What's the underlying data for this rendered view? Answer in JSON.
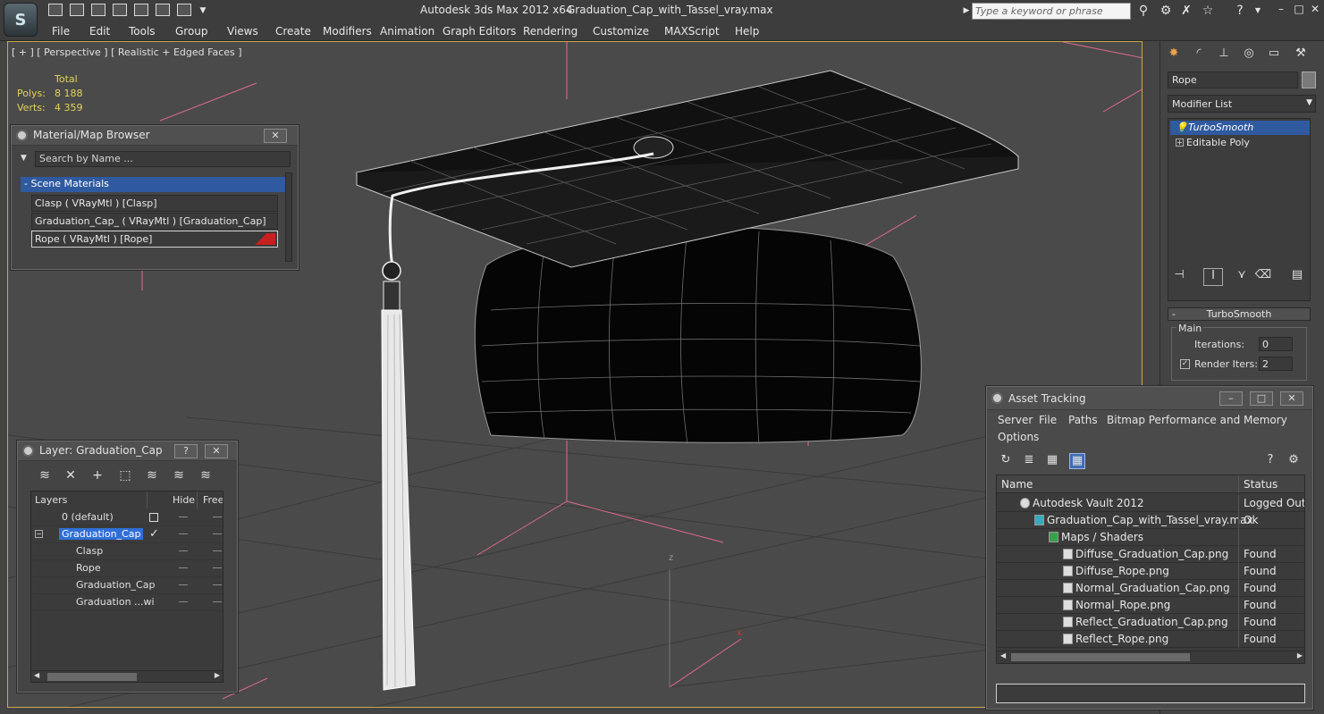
{
  "app": {
    "title": "Autodesk 3ds Max  2012 x64",
    "file": "Graduation_Cap_with_Tassel_vray.max",
    "search_placeholder": "Type a keyword or phrase"
  },
  "menu": [
    "File",
    "Edit",
    "Tools",
    "Group",
    "Views",
    "Create",
    "Modifiers",
    "Animation",
    "Graph Editors",
    "Rendering",
    "Customize",
    "MAXScript",
    "Help"
  ],
  "viewport": {
    "label": "[ + ] [ Perspective ] [ Realistic + Edged Faces ]",
    "stats": {
      "total_label": "Total",
      "polys_label": "Polys:",
      "polys": "8 188",
      "verts_label": "Verts:",
      "verts": "4 359"
    },
    "axis_z": "z",
    "axis_x": "x"
  },
  "material_browser": {
    "title": "Material/Map Browser",
    "search": "Search by Name ...",
    "group": "- Scene Materials",
    "items": [
      "Clasp  ( VRayMtl )  [Clasp]",
      "Graduation_Cap_  ( VRayMtl )  [Graduation_Cap]",
      "Rope  ( VRayMtl )  [Rope]"
    ],
    "swatch_color": "#c81f1f"
  },
  "layer_window": {
    "title": "Layer: Graduation_Cap",
    "help": "?",
    "columns": [
      "Layers",
      "Hide",
      "Free"
    ],
    "rows": [
      {
        "name": "0 (default)"
      },
      {
        "name": "Graduation_Cap"
      },
      {
        "name": "Clasp"
      },
      {
        "name": "Rope"
      },
      {
        "name": "Graduation_Cap"
      },
      {
        "name": "Graduation ...wi"
      }
    ]
  },
  "command_panel": {
    "object_name": "Rope",
    "modifier_list": "Modifier List",
    "stack": [
      "TurboSmooth",
      "Editable Poly"
    ],
    "rollout_title": "TurboSmooth",
    "group_main": "Main",
    "iterations_label": "Iterations:",
    "iterations": "0",
    "render_iters_label": "Render Iters:",
    "render_iters": "2"
  },
  "asset_tracking": {
    "title": "Asset Tracking",
    "menu": [
      "Server",
      "File",
      "Paths",
      "Bitmap Performance and Memory",
      "Options"
    ],
    "columns": [
      "Name",
      "Status"
    ],
    "rows": [
      {
        "name": "Autodesk Vault 2012",
        "status": "Logged Out ..."
      },
      {
        "name": "Graduation_Cap_with_Tassel_vray.max",
        "status": "Ok"
      },
      {
        "name": "Maps / Shaders",
        "status": ""
      },
      {
        "name": "Diffuse_Graduation_Cap.png",
        "status": "Found"
      },
      {
        "name": "Diffuse_Rope.png",
        "status": "Found"
      },
      {
        "name": "Normal_Graduation_Cap.png",
        "status": "Found"
      },
      {
        "name": "Normal_Rope.png",
        "status": "Found"
      },
      {
        "name": "Reflect_Graduation_Cap.png",
        "status": "Found"
      },
      {
        "name": "Reflect_Rope.png",
        "status": "Found"
      }
    ]
  },
  "colors": {
    "stats_yellow": "#e4d35a",
    "selection_blue": "#2f5aa0",
    "viewport_border": "#c9a84c",
    "guide_pink": "#e06a8a"
  }
}
